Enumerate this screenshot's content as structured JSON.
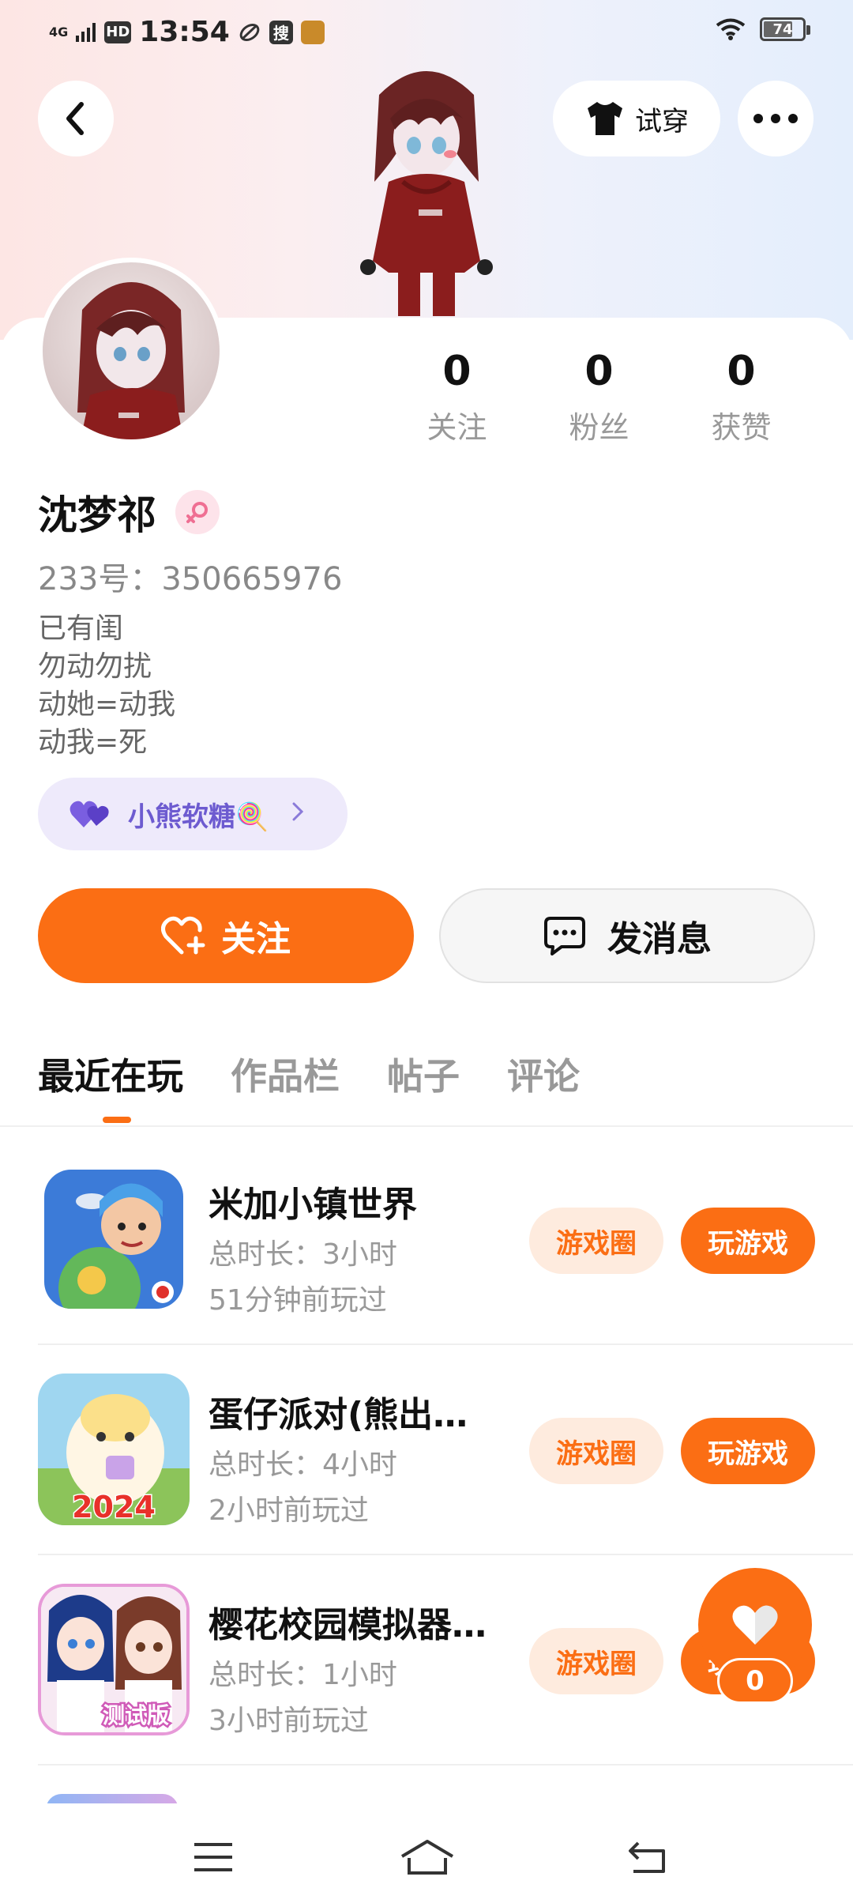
{
  "status_bar": {
    "network": "4G",
    "hd": "HD",
    "time": "13:54",
    "search_glyph": "搜",
    "battery": "74",
    "battery_level": 0.74
  },
  "header": {
    "tryon_label": "试穿"
  },
  "profile": {
    "stats": [
      {
        "value": "0",
        "label": "关注"
      },
      {
        "value": "0",
        "label": "粉丝"
      },
      {
        "value": "0",
        "label": "获赞"
      }
    ],
    "name": "沈梦祁",
    "uid": "233号：350665976",
    "bio": [
      "已有闺",
      "勿动勿扰",
      "动她=动我",
      "动我=死"
    ],
    "tag": "小熊软糖🍭"
  },
  "actions": {
    "follow": "关注",
    "message": "发消息"
  },
  "tabs": [
    "最近在玩",
    "作品栏",
    "帖子",
    "评论"
  ],
  "games": [
    {
      "title": "米加小镇世界",
      "duration": "总时长：3小时",
      "last_played": "51分钟前玩过",
      "circle": "游戏圈",
      "play": "玩游戏"
    },
    {
      "title": "蛋仔派对(熊出…",
      "duration": "总时长：4小时",
      "last_played": "2小时前玩过",
      "circle": "游戏圈",
      "play": "玩游戏",
      "icon_text": "2024"
    },
    {
      "title": "樱花校园模拟器…",
      "duration": "总时长：1小时",
      "last_played": "3小时前玩过",
      "circle": "游戏圈",
      "play": "玩游戏",
      "icon_text": "测试版"
    }
  ],
  "like_count": "0",
  "colors": {
    "accent": "#fb6e14",
    "accent_light": "#feebde",
    "tag_bg": "#eeeafb",
    "tag_text": "#6d5bd0"
  }
}
